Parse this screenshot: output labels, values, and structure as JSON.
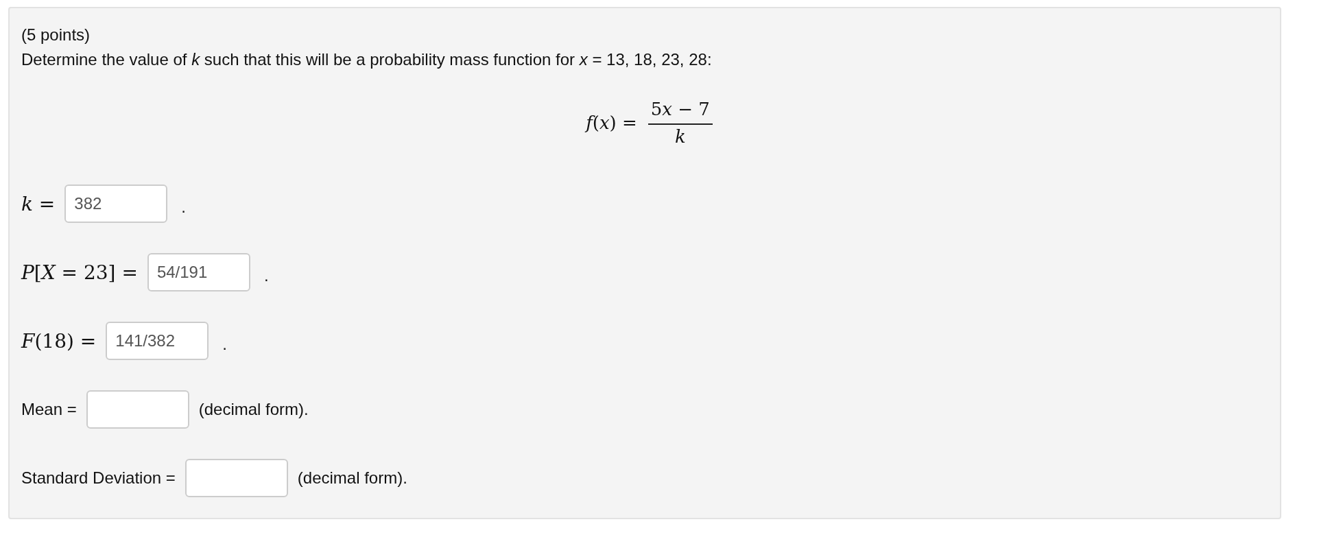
{
  "header": {
    "points": "(5 points)",
    "question": "Determine the value of *k* such that this will be a probability mass function for *x* = 13, 18, 23, 28:"
  },
  "formula": {
    "lhs": "*f*(*x*) =",
    "numerator": {
      "coefficient": "5",
      "variable": "x",
      "rest": "− 7"
    },
    "denominator": "*k*"
  },
  "answers": [
    {
      "kind": "math",
      "label": "*k* =",
      "value": "382",
      "suffix": "."
    },
    {
      "kind": "math",
      "label": "*P*[*X* = 23] =",
      "value": "54/191",
      "suffix": "."
    },
    {
      "kind": "math",
      "label": "*F*(18) =",
      "value": "141/382",
      "suffix": "."
    },
    {
      "kind": "plain",
      "label": "Mean =",
      "suffix": "(decimal form)."
    },
    {
      "kind": "plain",
      "label": "Standard Deviation =",
      "suffix": "(decimal form)."
    }
  ]
}
